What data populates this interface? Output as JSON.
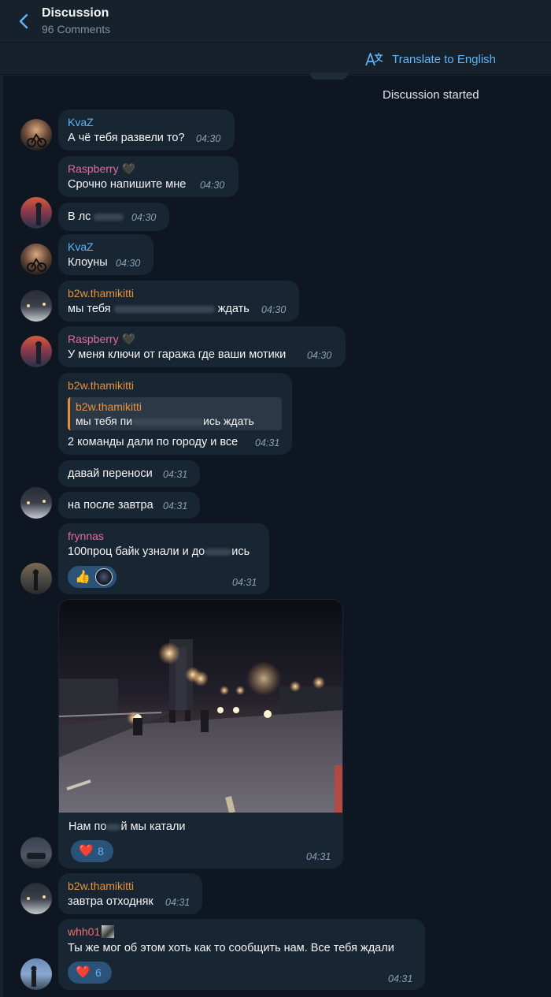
{
  "header": {
    "title": "Discussion",
    "subtitle": "96 Comments"
  },
  "translate": {
    "label": "Translate to English"
  },
  "service": {
    "text": "Discussion started"
  },
  "messages": [
    {
      "name": "KvaZ",
      "text": "А чё тебя развели то?",
      "time": "04:30"
    },
    {
      "name": "Raspberry",
      "emoji": "🖤",
      "text": "Срочно напишите мне",
      "time": "04:30"
    },
    {
      "text_a": "В лс",
      "time": "04:30"
    },
    {
      "name": "KvaZ",
      "text": "Клоуны",
      "time": "04:30"
    },
    {
      "name": "b2w.thamikitti",
      "text_a": "мы тебя",
      "text_b": "ждать",
      "time": "04:30"
    },
    {
      "name": "Raspberry",
      "emoji": "🖤",
      "text": "У меня ключи от гаража где ваши мотики",
      "time": "04:30"
    },
    {
      "name": "b2w.thamikitti",
      "quote_name": "b2w.thamikitti",
      "quote_a": "мы тебя пи",
      "quote_b": "ись ждать",
      "text": "2 команды дали по городу и все",
      "time": "04:31"
    },
    {
      "text": "давай переноси",
      "time": "04:31"
    },
    {
      "text": "на после завтра",
      "time": "04:31"
    },
    {
      "name": "frynnas",
      "text_a": "100проц байк узнали и до",
      "text_b": "ись",
      "reaction": "👍",
      "time": "04:31"
    },
    {
      "caption_a": "Нам по",
      "caption_b": "й мы катали",
      "reaction": "❤️",
      "reaction_count": "8",
      "time": "04:31"
    },
    {
      "name": "b2w.thamikitti",
      "text": "завтра отходняк",
      "time": "04:31"
    },
    {
      "name": "whh01",
      "text": "Ты же мог об этом хоть как то сообщить нам. Все тебя ждали",
      "reaction": "❤️",
      "reaction_count": "6",
      "time": "04:31"
    }
  ]
}
